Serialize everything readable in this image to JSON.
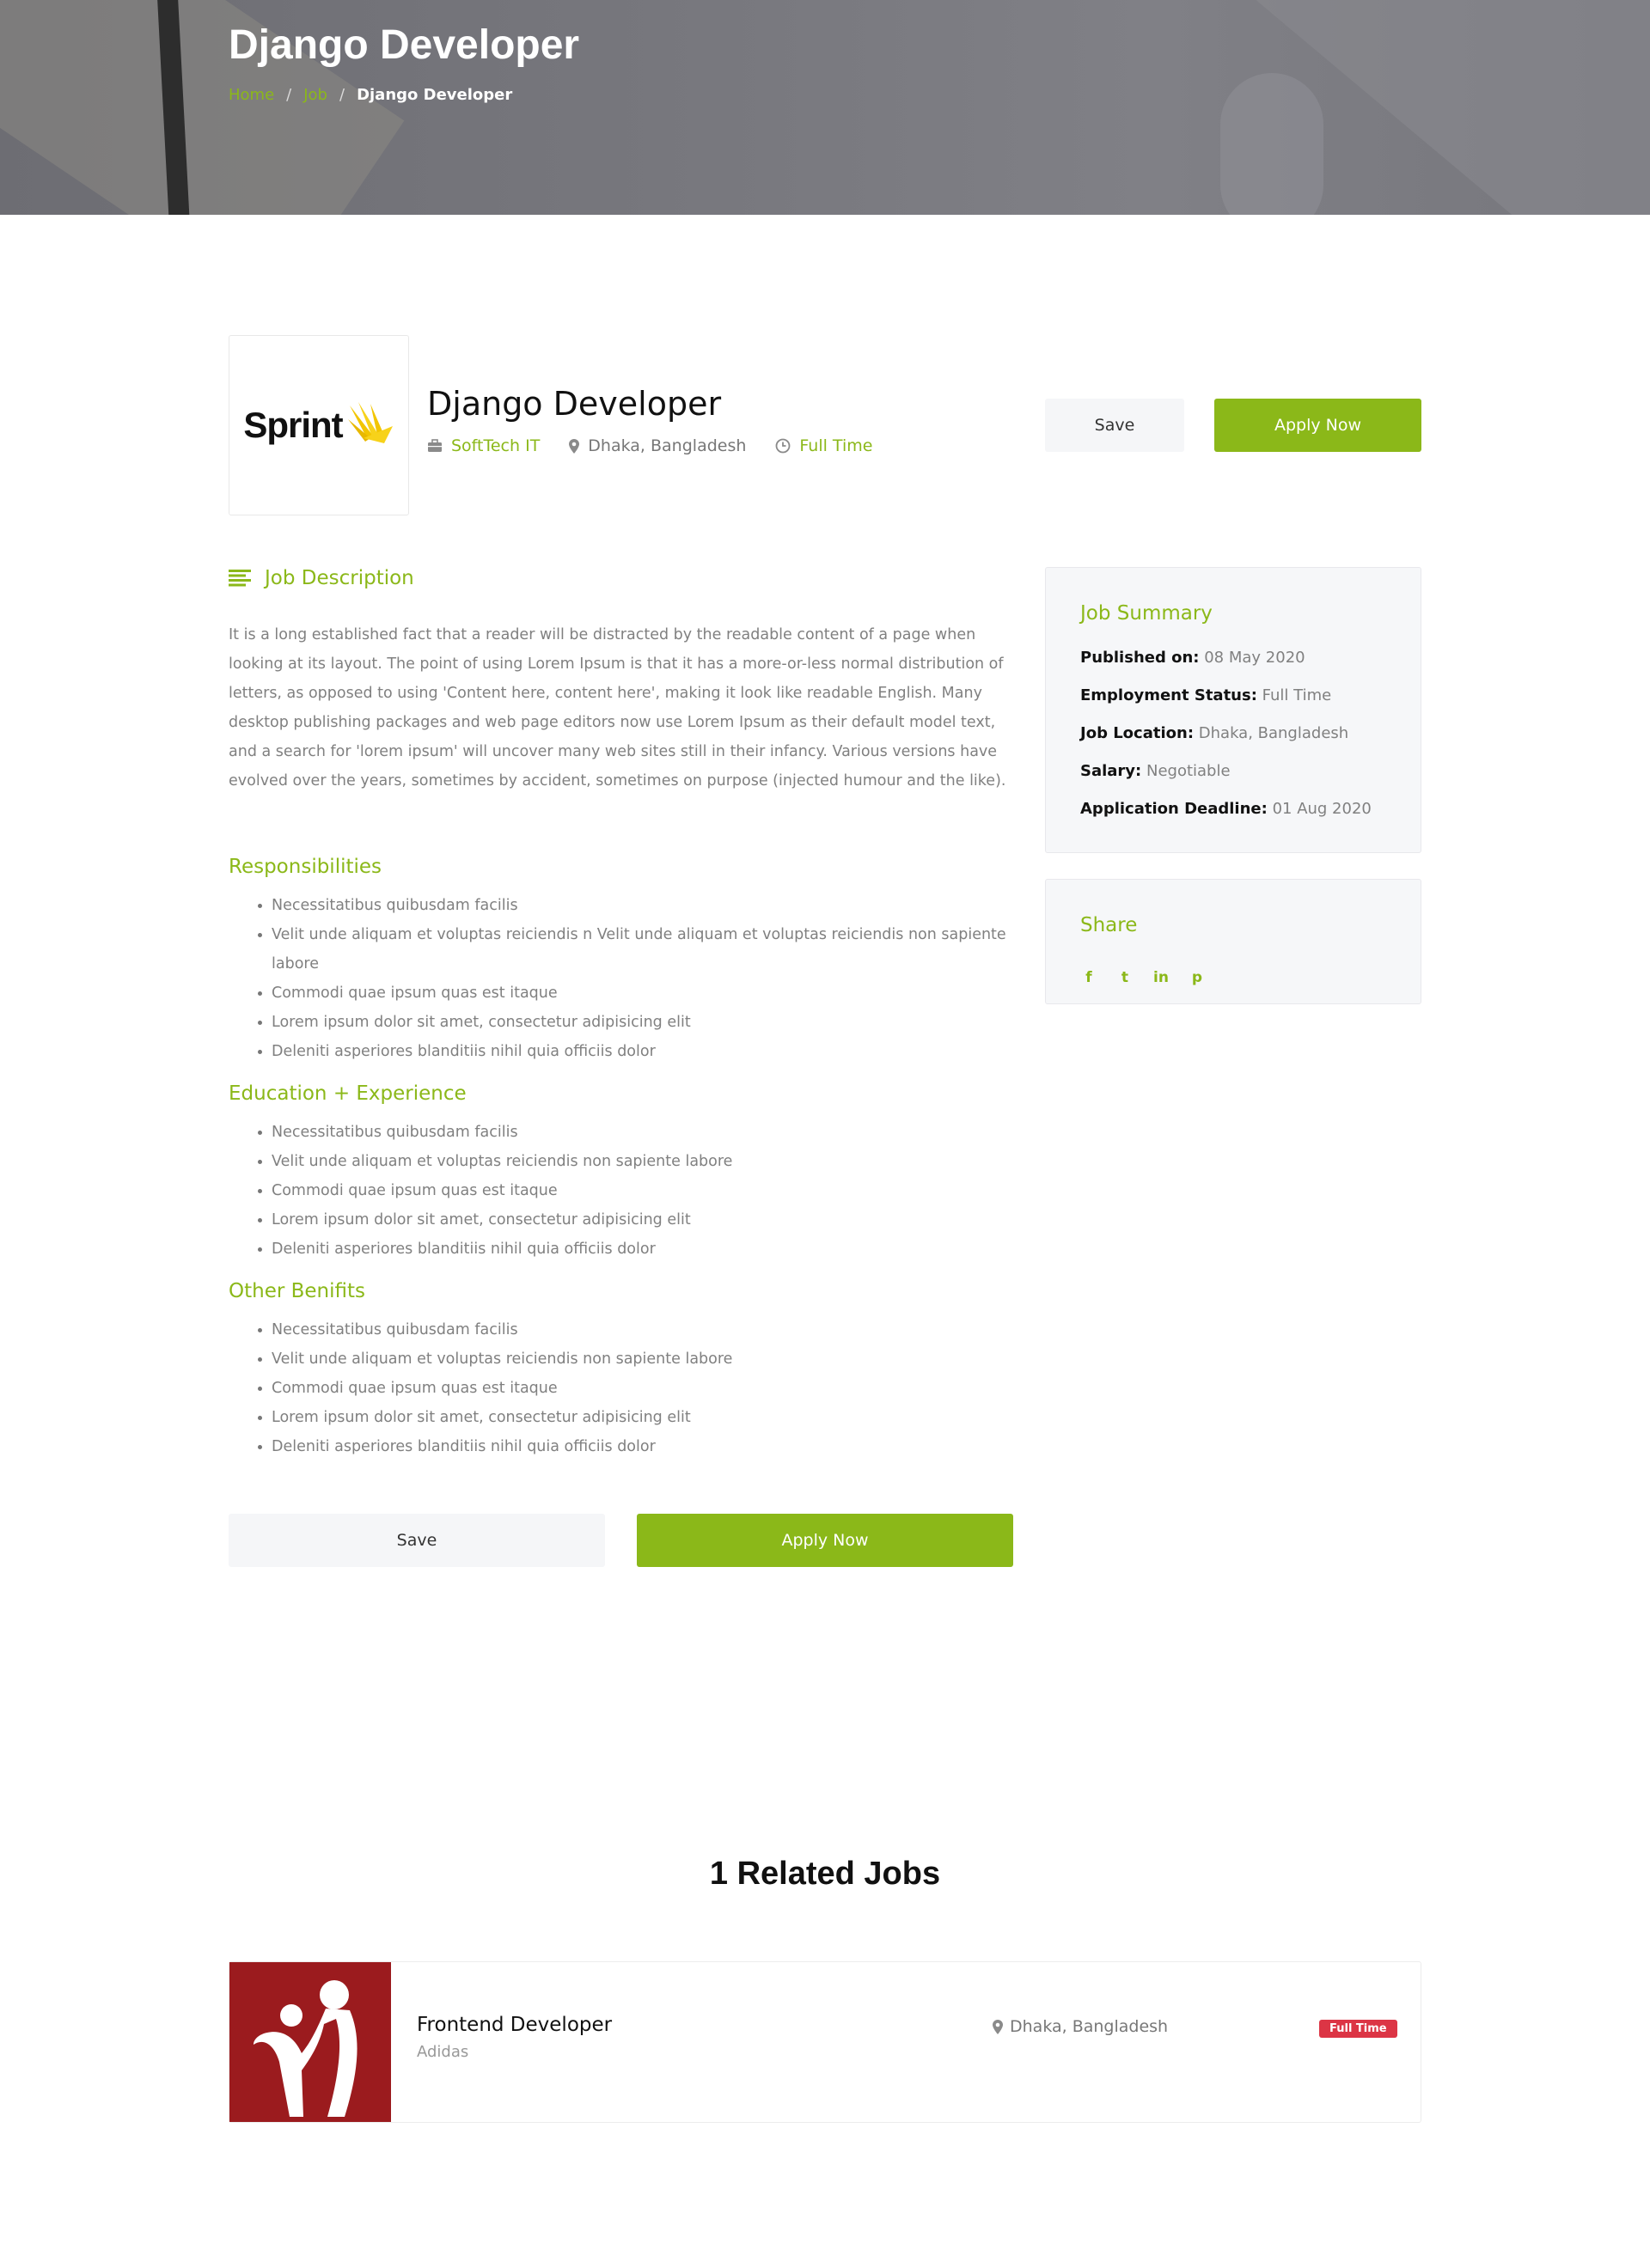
{
  "colors": {
    "accent": "#8bb819",
    "badge": "#dc3545",
    "card_bg": "#f6f7f9"
  },
  "hero": {
    "title": "Django Developer",
    "breadcrumb": {
      "home": "Home",
      "sep1": "/",
      "job": "Job",
      "sep2": "/",
      "current": "Django Developer"
    }
  },
  "job": {
    "logo_text": "Sprint",
    "title": "Django Developer",
    "company": "SoftTech IT",
    "location": "Dhaka, Bangladesh",
    "type": "Full Time",
    "icons": {
      "company": "briefcase-icon",
      "location": "map-pin-icon",
      "type": "clock-icon"
    },
    "save_label": "Save",
    "apply_label": "Apply Now"
  },
  "description": {
    "heading": "Job Description",
    "heading_icon": "align-left-icon",
    "text": "It is a long established fact that a reader will be distracted by the readable content of a page when looking at its layout. The point of using Lorem Ipsum is that it has a more-or-less normal distribution of letters, as opposed to using 'Content here, content here', making it look like readable English. Many desktop publishing packages and web page editors now use Lorem Ipsum as their default model text, and a search for 'lorem ipsum' will uncover many web sites still in their infancy. Various versions have evolved over the years, sometimes by accident, sometimes on purpose (injected humour and the like)."
  },
  "responsibilities": {
    "heading": "Responsibilities",
    "items": [
      "Necessitatibus quibusdam facilis",
      "Velit unde aliquam et voluptas reiciendis n Velit unde aliquam et voluptas reiciendis non sapiente labore",
      "Commodi quae ipsum quas est itaque",
      "Lorem ipsum dolor sit amet, consectetur adipisicing elit",
      "Deleniti asperiores blanditiis nihil quia officiis dolor"
    ]
  },
  "education": {
    "heading": "Education + Experience",
    "items": [
      "Necessitatibus quibusdam facilis",
      "Velit unde aliquam et voluptas reiciendis non sapiente labore",
      "Commodi quae ipsum quas est itaque",
      "Lorem ipsum dolor sit amet, consectetur adipisicing elit",
      "Deleniti asperiores blanditiis nihil quia officiis dolor"
    ]
  },
  "benefits": {
    "heading": "Other Benifits",
    "items": [
      "Necessitatibus quibusdam facilis",
      "Velit unde aliquam et voluptas reiciendis non sapiente labore",
      "Commodi quae ipsum quas est itaque",
      "Lorem ipsum dolor sit amet, consectetur adipisicing elit",
      "Deleniti asperiores blanditiis nihil quia officiis dolor"
    ]
  },
  "bottom_buttons": {
    "save_label": "Save",
    "apply_label": "Apply Now"
  },
  "summary": {
    "heading": "Job Summary",
    "published_label": "Published on:",
    "published_value": "08 May 2020",
    "employment_label": "Employment Status:",
    "employment_value": "Full Time",
    "location_label": "Job Location:",
    "location_value": "Dhaka, Bangladesh",
    "salary_label": "Salary:",
    "salary_value": "Negotiable",
    "deadline_label": "Application Deadline:",
    "deadline_value": "01 Aug 2020"
  },
  "share": {
    "heading": "Share",
    "icons": [
      "facebook-icon",
      "twitter-icon",
      "linkedin-icon",
      "pinterest-icon"
    ],
    "glyphs": {
      "facebook": "f",
      "twitter": "t",
      "linkedin": "in",
      "pinterest": "p"
    }
  },
  "related": {
    "heading": "1 Related Jobs",
    "jobs": [
      {
        "title": "Frontend Developer",
        "company": "Adidas",
        "location": "Dhaka, Bangladesh",
        "type": "Full Time"
      }
    ]
  }
}
